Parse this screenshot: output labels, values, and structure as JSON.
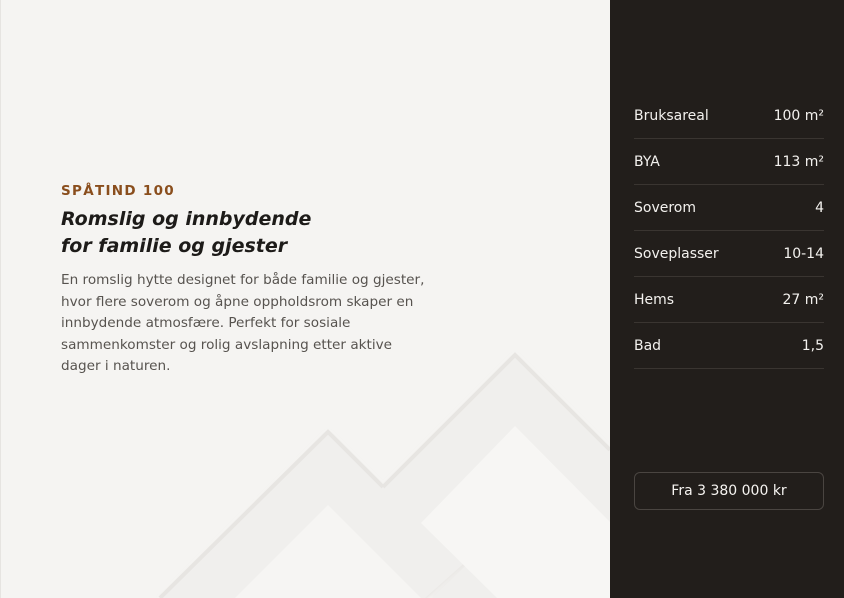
{
  "colors": {
    "left_background": "#f5f4f2",
    "right_background": "#221e1b",
    "accent": "#8a4e1d",
    "text_dark": "#1d1b19",
    "text_body": "#57534f",
    "text_light": "#f3f1ee"
  },
  "hero": {
    "eyebrow": "SPÅTIND 100",
    "title_line1": "Romslig og innbydende",
    "title_line2": "for familie og gjester",
    "description": "En romslig hytte designet for både familie og gjester, hvor flere soverom og åpne oppholdsrom skaper en innbydende atmosfære. Perfekt for sosiale sammenkomster og rolig avslapning etter aktive dager i naturen."
  },
  "specs": [
    {
      "label": "Bruksareal",
      "value": "100 m²"
    },
    {
      "label": "BYA",
      "value": "113 m²"
    },
    {
      "label": "Soverom",
      "value": "4"
    },
    {
      "label": "Soveplasser",
      "value": "10-14"
    },
    {
      "label": "Hems",
      "value": "27 m²"
    },
    {
      "label": "Bad",
      "value": "1,5"
    }
  ],
  "price_button": {
    "label": "Fra 3 380 000 kr"
  }
}
